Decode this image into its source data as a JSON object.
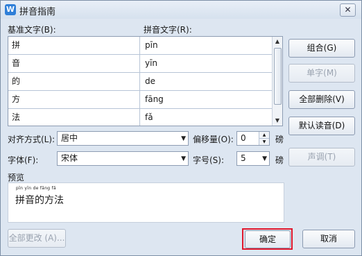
{
  "window": {
    "title": "拼音指南",
    "app_icon": "W",
    "close_icon": "✕"
  },
  "labels": {
    "base_text": "基准文字(B):",
    "pinyin_text": "拼音文字(R):",
    "align": "对齐方式(L):",
    "offset": "偏移量(O):",
    "offset_unit": "磅",
    "font": "字体(F):",
    "size": "字号(S):",
    "size_unit": "磅",
    "preview": "预览"
  },
  "rows": [
    {
      "base": "拼",
      "pinyin": "pīn"
    },
    {
      "base": "音",
      "pinyin": "yīn"
    },
    {
      "base": "的",
      "pinyin": "de"
    },
    {
      "base": "方",
      "pinyin": "fāng"
    },
    {
      "base": "法",
      "pinyin": "fǎ"
    }
  ],
  "buttons": {
    "combine": "组合(G)",
    "single": "单字(M)",
    "delete_all": "全部删除(V)",
    "default_reading": "默认读音(D)",
    "tone": "声调(T)",
    "change_all": "全部更改 (A)...",
    "ok": "确定",
    "cancel": "取消"
  },
  "fields": {
    "align_value": "居中",
    "offset_value": "0",
    "font_value": "宋体",
    "size_value": "5"
  },
  "preview": {
    "ruby": "pīn yīn de fāng fǎ",
    "text": "拼音的方法"
  },
  "colors": {
    "highlight": "#e0182d"
  }
}
